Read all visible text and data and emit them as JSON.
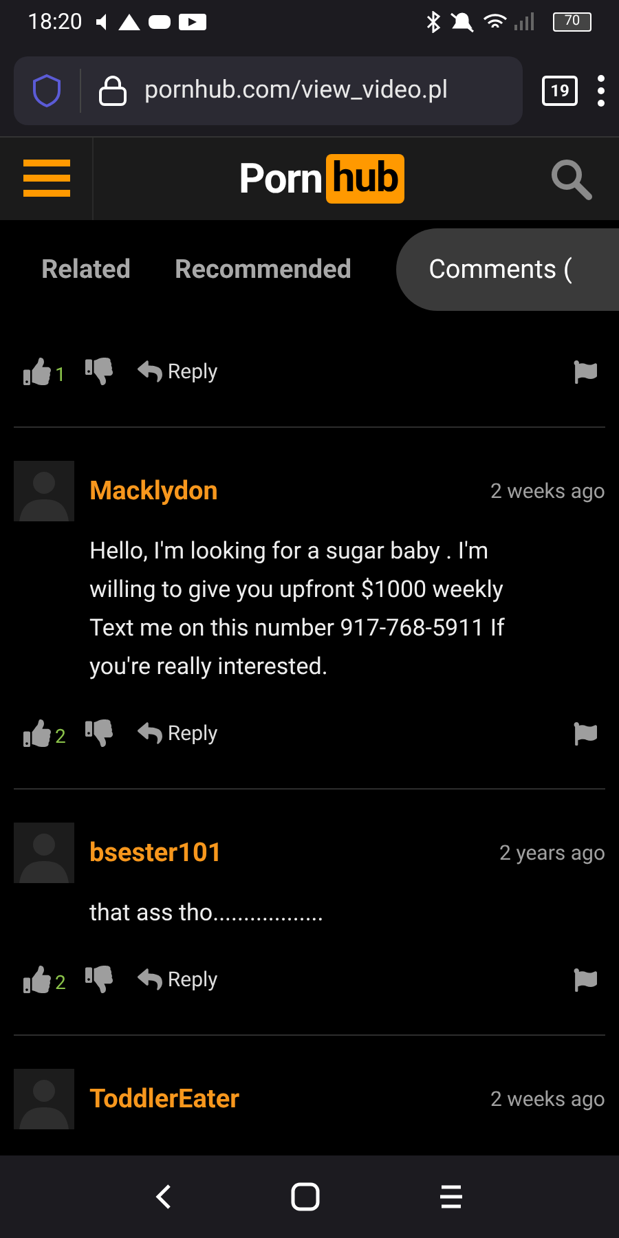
{
  "status_bar": {
    "time": "18:20",
    "battery": "70"
  },
  "browser": {
    "url": "pornhub.com/view_video.pl",
    "tab_count": "19"
  },
  "site_header": {
    "logo_left": "Porn",
    "logo_right": "hub"
  },
  "tabs": [
    {
      "label": "Related",
      "selected": false
    },
    {
      "label": "Recommended",
      "selected": false
    },
    {
      "label": "Comments (",
      "selected": true
    }
  ],
  "partial_comment": {
    "likes": "1",
    "reply": "Reply"
  },
  "comments": [
    {
      "username": "Macklydon",
      "time": "2 weeks ago",
      "text": "Hello, I'm looking for a sugar baby . I'm willing to give you upfront $1000 weekly Text me on this number 917-768-5911 If you're really interested.",
      "likes": "2",
      "reply": "Reply"
    },
    {
      "username": "bsester101",
      "time": "2 years ago",
      "text": "that ass tho..................",
      "likes": "2",
      "reply": "Reply"
    },
    {
      "username": "ToddlerEater",
      "time": "2 weeks ago"
    }
  ]
}
